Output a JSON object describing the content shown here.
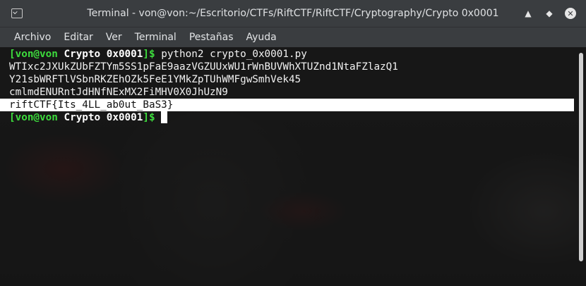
{
  "window": {
    "title": "Terminal - von@von:~/Escritorio/CTFs/RiftCTF/RiftCTF/Cryptography/Crypto 0x0001",
    "minimize_glyph": "▲",
    "maximize_glyph": "◆",
    "close_glyph": "✕"
  },
  "menu": {
    "items": [
      "Archivo",
      "Editar",
      "Ver",
      "Terminal",
      "Pestañas",
      "Ayuda"
    ]
  },
  "terminal": {
    "prompt_open": "[",
    "prompt_user": "von@von",
    "prompt_cwd": "Crypto 0x0001",
    "prompt_close": "]$",
    "command": "python2 crypto_0x0001.py",
    "output": [
      "WTIxc2JXUkZUbFZTYm5SS1pFaE9aazVGZUUxWU1rWnBUVWhXTUZnd1NtaFZlazQ1",
      "Y21sbWRFTlVSbnRKZEhOZk5FeE1YMkZpTUhWMFgwSmhVek45",
      "cmlmdENURntJdHNfNExMX2FiMHV0X0JhUzN9"
    ],
    "flag": "riftCTF{Its_4LL_ab0ut_BaS3}"
  }
}
